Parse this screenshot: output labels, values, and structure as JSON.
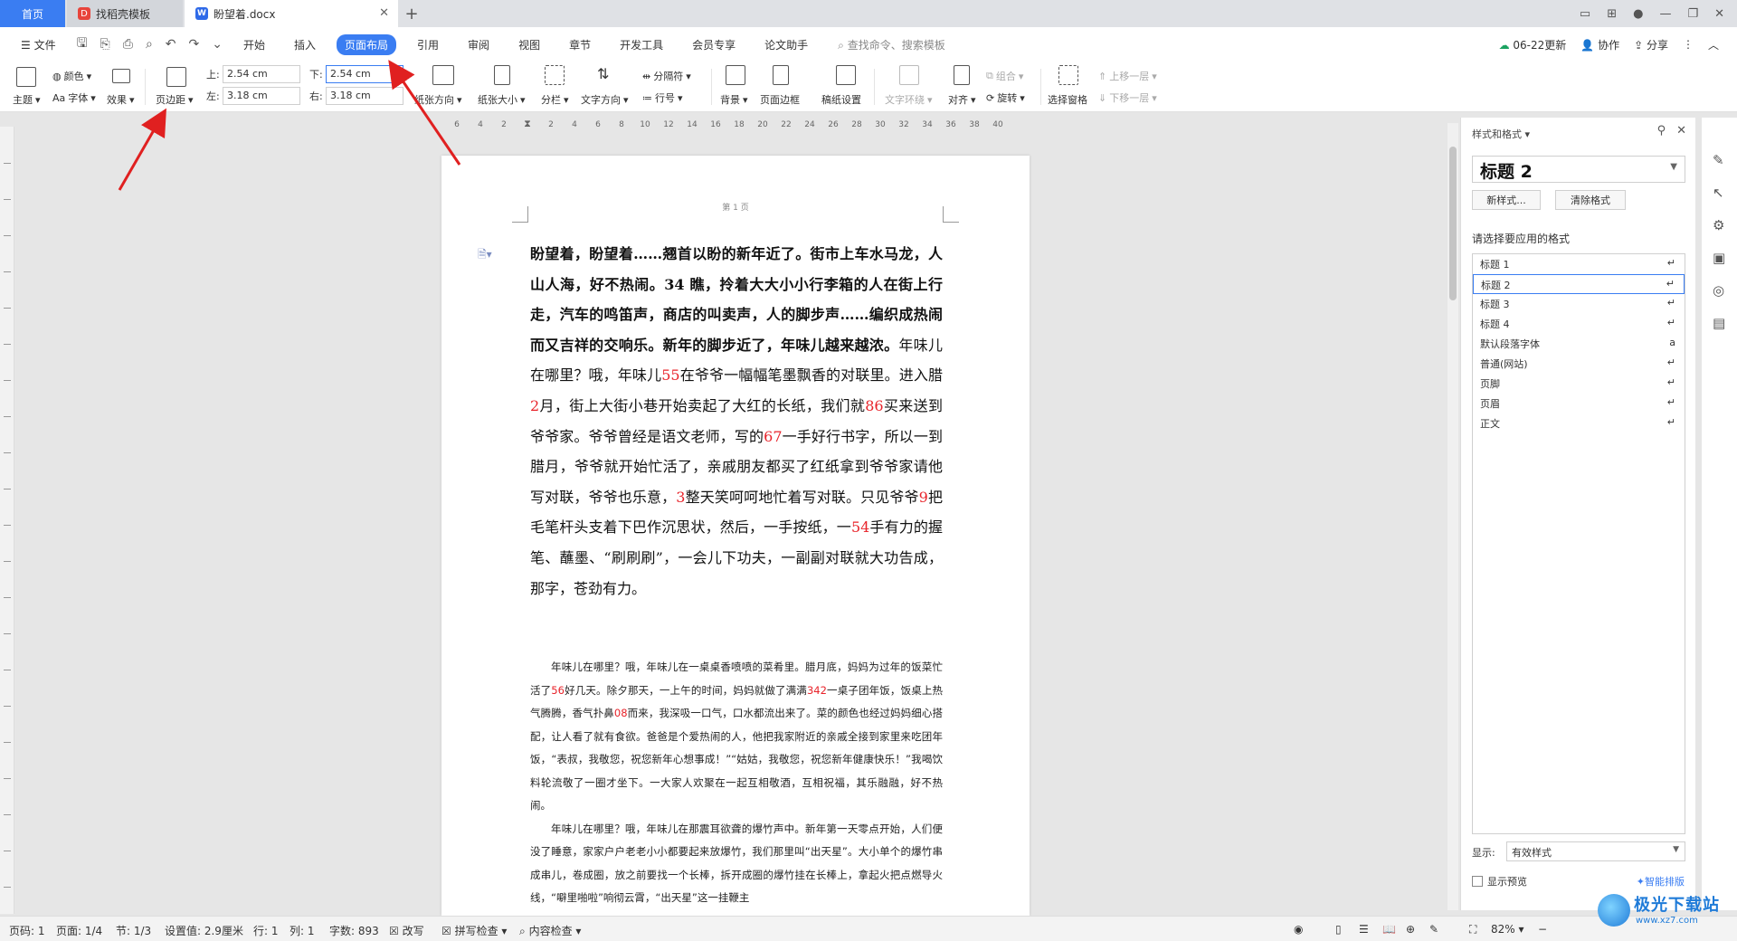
{
  "titlebar": {
    "tabs": [
      {
        "label": "首页"
      },
      {
        "label": "找稻壳模板"
      },
      {
        "label": "盼望着.docx"
      }
    ],
    "new_tab": "+"
  },
  "menubar": {
    "file_label": "文件",
    "items": [
      "开始",
      "插入",
      "页面布局",
      "引用",
      "审阅",
      "视图",
      "章节",
      "开发工具",
      "会员专享",
      "论文助手"
    ],
    "active_item": "页面布局",
    "search_placeholder": "查找命令、搜索模板",
    "update_label": "06-22更新",
    "collab_label": "协作",
    "share_label": "分享"
  },
  "ribbon": {
    "theme": "主题",
    "color": "颜色",
    "font": "字体",
    "effect": "效果",
    "margins": "页边距",
    "top_label": "上:",
    "top_value": "2.54 cm",
    "bottom_label": "下:",
    "bottom_value": "2.54 cm",
    "left_label": "左:",
    "left_value": "3.18 cm",
    "right_label": "右:",
    "right_value": "3.18 cm",
    "orientation": "纸张方向",
    "size": "纸张大小",
    "columns": "分栏",
    "text_direction": "文字方向",
    "breaks": "分隔符",
    "line_numbers": "行号",
    "background": "背景",
    "page_border": "页面边框",
    "draft_paper": "稿纸设置",
    "text_wrap": "文字环绕",
    "align": "对齐",
    "group": "组合",
    "rotate": "旋转",
    "selection_pane": "选择窗格",
    "bring_forward": "上移一层",
    "send_backward": "下移一层"
  },
  "ruler": {
    "marks": [
      "6",
      "4",
      "2",
      "2",
      "4",
      "6",
      "8",
      "10",
      "12",
      "14",
      "16",
      "18",
      "20",
      "22",
      "24",
      "26",
      "28",
      "30",
      "32",
      "34",
      "36",
      "38",
      "40"
    ]
  },
  "document": {
    "page_header": "第 1 页",
    "bold_text": "盼望着，盼望着……翘首以盼的新年近了。街市上车水马龙，人山人海，好不热闹。34 瞧，拎着大大小小行李箱的人在街上行走，汽车的鸣笛声，商店的叫卖声，人的脚步声……编织成热闹而又吉祥的交响乐。新年的脚步近了，年味儿越来越浓。",
    "p1_a": "年味儿在哪里？哦，年味儿",
    "n1": "55",
    "p1_b": "在爷爷一幅幅笔墨飘香的对联里。进入腊",
    "n2": "2",
    "p1_c": "月，街上大街小巷开始卖起了大红的长纸，我们就",
    "n3": "86",
    "p1_d": "买来送到爷爷家。爷爷曾经是语文老师，写的",
    "n4": "67",
    "p1_e": "一手好行书字，所以一到腊月，爷爷就开始忙活了，亲戚朋友都买了红纸拿到爷爷家请他写对联，爷爷也乐意，",
    "n5": "3",
    "p1_f": "整天笑呵呵地忙着写对联。只见爷爷",
    "n6": "9",
    "p1_g": "把毛笔杆头支着下巴作沉思状，然后，一手按纸，一",
    "n7": "54",
    "p1_h": "手有力的握笔、蘸墨、“刷刷刷”，一会儿下功夫，一副副对联就大功告成，那字，苍劲有力。",
    "s1_a": "年味儿在哪里？哦，年味儿在一桌桌香喷喷的菜肴里。腊月底，妈妈为过年的饭菜忙活了",
    "s_n1": "56",
    "s1_b": "好几天。除夕那天，一上午的时间，妈妈就做了满满",
    "s_n2": "342",
    "s1_c": "一桌子团年饭，饭桌上热气腾腾，香气扑鼻",
    "s_n3": "08",
    "s1_d": "而来，我深吸一口气，口水都流出来了。菜的颜色也经过妈妈细心搭配，让人看了就有食欲。爸爸是个爱热闹的人，他把我家附近的亲戚全接到家里来吃团年饭，“表叔，我敬您，祝您新年心想事成！”“姑姑，我敬您，祝您新年健康快乐！”我喝饮料轮流敬了一圈才坐下。一大家人欢聚在一起互相敬酒，互相祝福，其乐融融，好不热闹。",
    "s2": "年味儿在哪里？哦，年味儿在那震耳欲聋的爆竹声中。新年第一天零点开始，人们便没了睡意，家家户户老老小小都要起来放爆竹，我们那里叫“出天星”。大小单个的爆竹串成串儿，卷成圈，放之前要找一个长棒，拆开成圈的爆竹挂在长棒上，拿起火把点燃导火线，“噼里啪啦”响彻云霄，“出天星”这一挂鞭主"
  },
  "styles_pane": {
    "title": "样式和格式",
    "current_style": "标题  2",
    "new_style": "新样式...",
    "clear_format": "清除格式",
    "apply_label": "请选择要应用的格式",
    "items": [
      {
        "label": "标题 1",
        "mark": "↵"
      },
      {
        "label": "标题 2",
        "mark": "↵"
      },
      {
        "label": "标题 3",
        "mark": "↵"
      },
      {
        "label": "标题 4",
        "mark": "↵"
      },
      {
        "label": "默认段落字体",
        "mark": "a"
      },
      {
        "label": "普通(网站)",
        "mark": "↵"
      },
      {
        "label": "页脚",
        "mark": "↵"
      },
      {
        "label": "页眉",
        "mark": "↵"
      },
      {
        "label": "正文",
        "mark": "↵"
      }
    ],
    "selected_index": 1,
    "show_label": "显示:",
    "show_value": "有效样式",
    "preview_label": "显示预览",
    "smart_label": "智能排版"
  },
  "statusbar": {
    "page_code": "页码: 1",
    "page": "页面: 1/4",
    "section": "节: 1/3",
    "setting": "设置值: 2.9厘米",
    "row": "行: 1",
    "col": "列: 1",
    "word_count": "字数: 893",
    "revise": "改写",
    "spell_check": "拼写检查",
    "content_check": "内容检查",
    "zoom": "82%"
  },
  "watermark": {
    "name": "极光下载站",
    "url": "www.xz7.com"
  },
  "colors": {
    "accent": "#3a7df2",
    "number_red": "#e8232a",
    "arrow_red": "#e02020"
  }
}
